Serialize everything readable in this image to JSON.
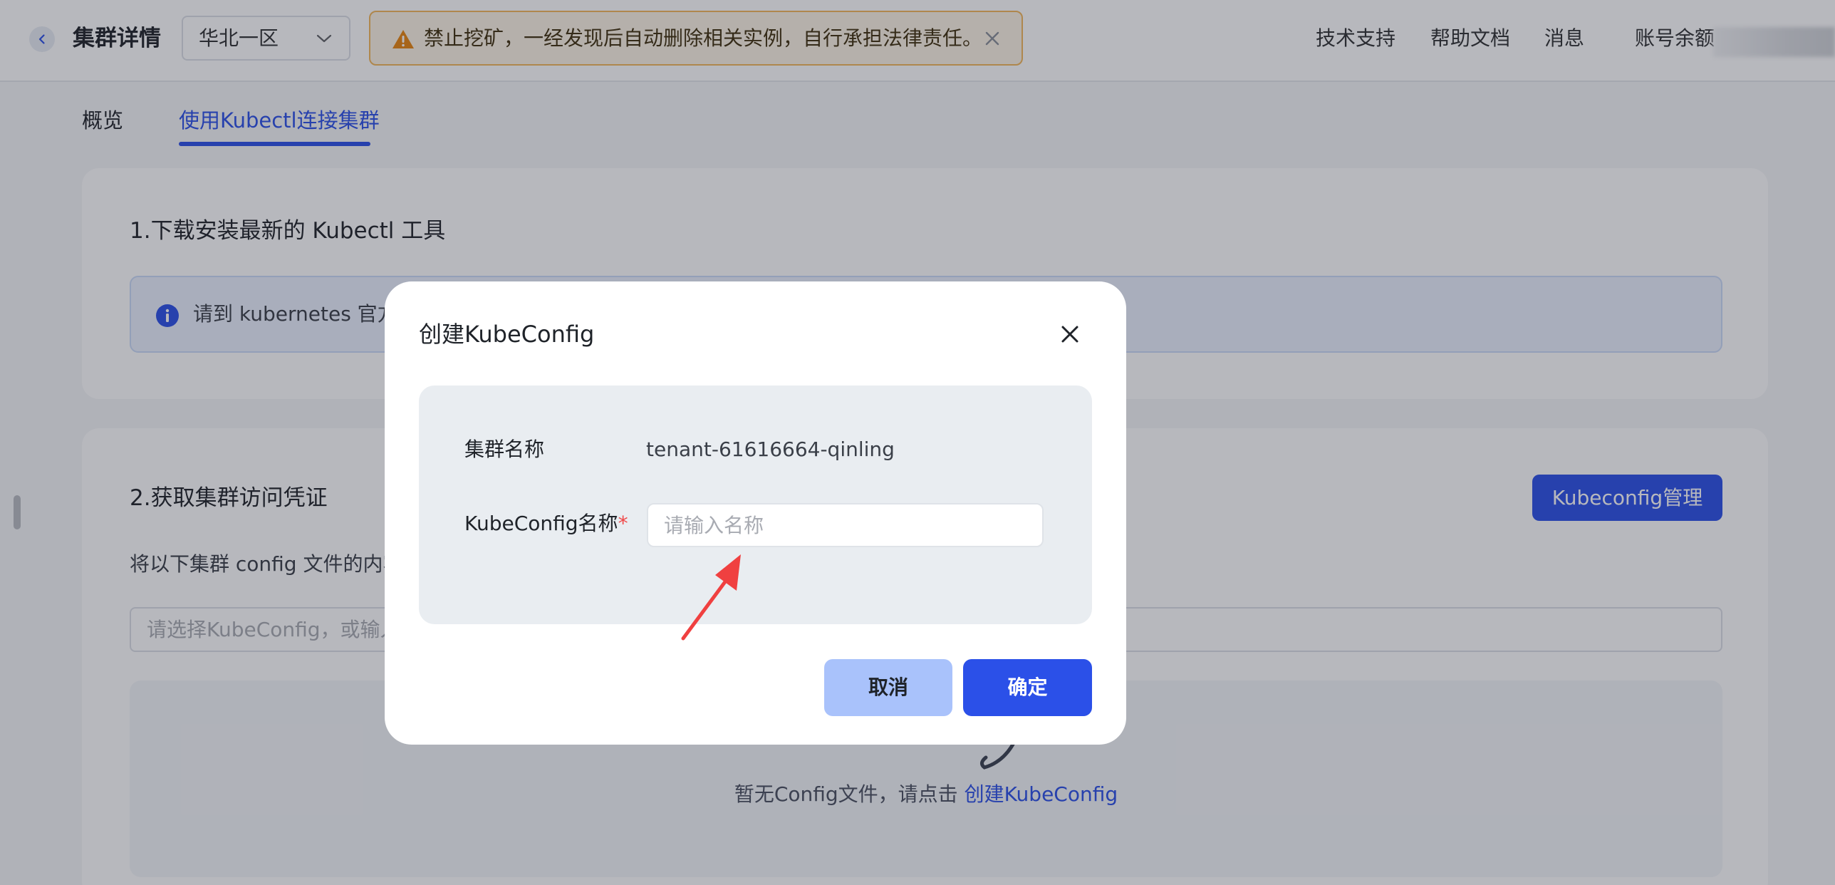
{
  "header": {
    "title": "集群详情",
    "region": "华北一区",
    "alert_text": "禁止挖矿，一经发现后自动删除相关实例，自行承担法律责任。",
    "nav": [
      "技术支持",
      "帮助文档",
      "消息",
      "账号余额"
    ]
  },
  "tabs": [
    "概览",
    "使用Kubectl连接集群"
  ],
  "section1": {
    "title": "1.下载安装最新的 Kubectl 工具",
    "info_text": "请到 kubernetes 官方..."
  },
  "section2": {
    "title": "2.获取集群访问凭证",
    "manage_button": "Kubeconfig管理",
    "desc": "将以下集群 config 文件的内容...",
    "select_placeholder": "请选择KubeConfig，或输入...",
    "empty_text": "暂无Config文件，请点击",
    "empty_link": "创建KubeConfig"
  },
  "modal": {
    "title": "创建KubeConfig",
    "cluster_label": "集群名称",
    "cluster_value": "tenant-61616664-qinling",
    "name_label": "KubeConfig名称",
    "required_mark": "*",
    "name_placeholder": "请输入名称",
    "cancel": "取消",
    "confirm": "确定"
  },
  "colors": {
    "primary": "#2b50e8",
    "warning_border": "#f3b75a",
    "annotation_arrow": "#f04040"
  }
}
